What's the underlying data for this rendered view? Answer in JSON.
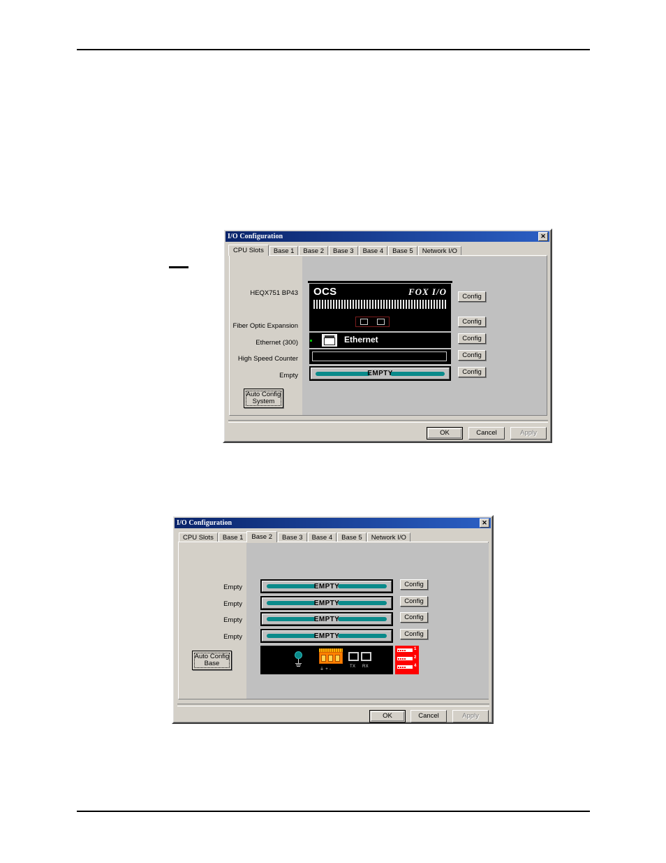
{
  "page": {
    "rules": {
      "top_visible": true,
      "bottom_visible": true
    },
    "leader_dash": "—"
  },
  "dialog1": {
    "title": "I/O Configuration",
    "close_label": "✕",
    "tabs": [
      {
        "label": "CPU Slots",
        "active": true
      },
      {
        "label": "Base 1",
        "active": false
      },
      {
        "label": "Base 2",
        "active": false
      },
      {
        "label": "Base 3",
        "active": false
      },
      {
        "label": "Base 4",
        "active": false
      },
      {
        "label": "Base 5",
        "active": false
      },
      {
        "label": "Network I/O",
        "active": false
      }
    ],
    "slots": [
      {
        "label": "HEQX751 BP43",
        "config_label": "Config",
        "module": "ocs-fox-io"
      },
      {
        "label": "Fiber Optic Expansion",
        "config_label": "Config",
        "module": "fiber-ports"
      },
      {
        "label": "Ethernet (300)",
        "config_label": "Config",
        "module": "ethernet"
      },
      {
        "label": "High Speed Counter",
        "config_label": "Config",
        "module": "hsc"
      },
      {
        "label": "Empty",
        "config_label": "Config",
        "module": "empty"
      }
    ],
    "module_text": {
      "ocs": "OCS",
      "fox_io": "FOX I/O",
      "ethernet": "Ethernet",
      "empty": "EMPTY"
    },
    "auto_config": "Auto Config\nSystem",
    "footer": {
      "ok": "OK",
      "cancel": "Cancel",
      "apply": "Apply"
    }
  },
  "dialog2": {
    "title": "I/O Configuration",
    "close_label": "✕",
    "tabs": [
      {
        "label": "CPU Slots",
        "active": false
      },
      {
        "label": "Base 1",
        "active": false
      },
      {
        "label": "Base 2",
        "active": true
      },
      {
        "label": "Base 3",
        "active": false
      },
      {
        "label": "Base 4",
        "active": false
      },
      {
        "label": "Base 5",
        "active": false
      },
      {
        "label": "Network I/O",
        "active": false
      }
    ],
    "slots": [
      {
        "label": "Empty",
        "config_label": "Config",
        "module_text": "EMPTY"
      },
      {
        "label": "Empty",
        "config_label": "Config",
        "module_text": "EMPTY"
      },
      {
        "label": "Empty",
        "config_label": "Config",
        "module_text": "EMPTY"
      },
      {
        "label": "Empty",
        "config_label": "Config",
        "module_text": "EMPTY"
      }
    ],
    "base_graphic": {
      "tx_label": "TX",
      "rx_label": "RX",
      "connector_numbers": [
        "1",
        "2",
        "4"
      ]
    },
    "auto_config": "Auto Config\nBase",
    "footer": {
      "ok": "OK",
      "cancel": "Cancel",
      "apply": "Apply"
    }
  },
  "colors": {
    "titlebar_start": "#0a246a",
    "titlebar_end": "#2b5fc4",
    "dialog_face": "#d4d0c8",
    "panel_gray": "#c0c0c0",
    "teal": "#0a8a8a",
    "red": "#ff0000",
    "orange": "#ff8000"
  }
}
